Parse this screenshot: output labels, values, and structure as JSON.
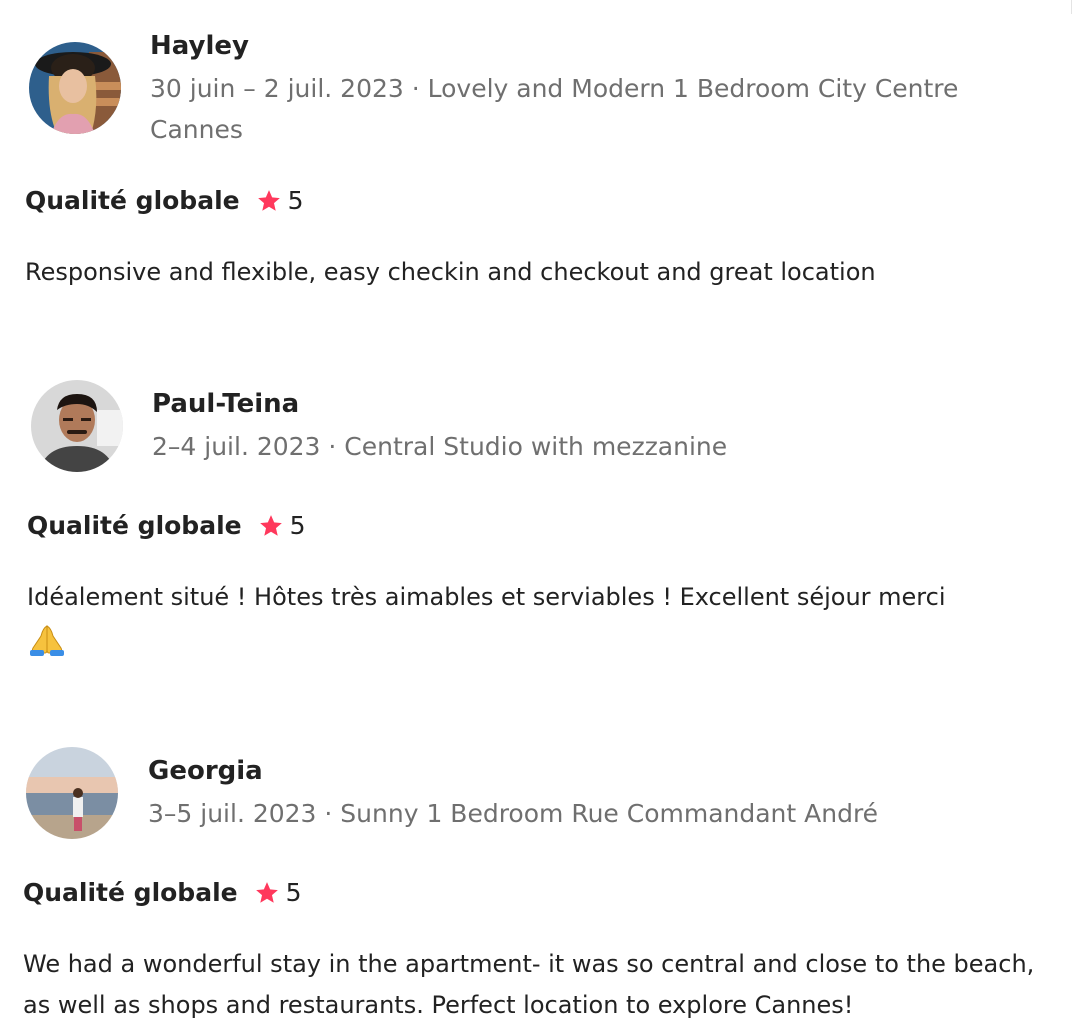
{
  "reviews": [
    {
      "name": "Hayley",
      "meta": "30 juin – 2 juil. 2023 · Lovely and Modern 1 Bedroom City Centre Cannes",
      "rating_label": "Qualité globale",
      "rating_value": "5",
      "text": "Responsive and flexible, easy checkin and checkout and great location",
      "avatar_icon": "avatar-photo"
    },
    {
      "name": "Paul-Teina",
      "meta": "2–4 juil. 2023 · Central Studio with mezzanine",
      "rating_label": "Qualité globale",
      "rating_value": "5",
      "text": "Idéalement situé ! Hôtes très aimables et serviables ! Excellent séjour merci",
      "emoji_icon": "folded-hands-icon",
      "avatar_icon": "avatar-photo"
    },
    {
      "name": "Georgia",
      "meta": "3–5 juil. 2023 · Sunny 1 Bedroom Rue Commandant André",
      "rating_label": "Qualité globale",
      "rating_value": "5",
      "text": "We had a wonderful stay in the apartment- it was so central and close to the beach, as well as shops and restaurants. Perfect location to explore Cannes!",
      "avatar_icon": "avatar-photo"
    }
  ],
  "colors": {
    "star": "#ff385c",
    "text": "#222222",
    "meta": "#6f6f6f"
  }
}
